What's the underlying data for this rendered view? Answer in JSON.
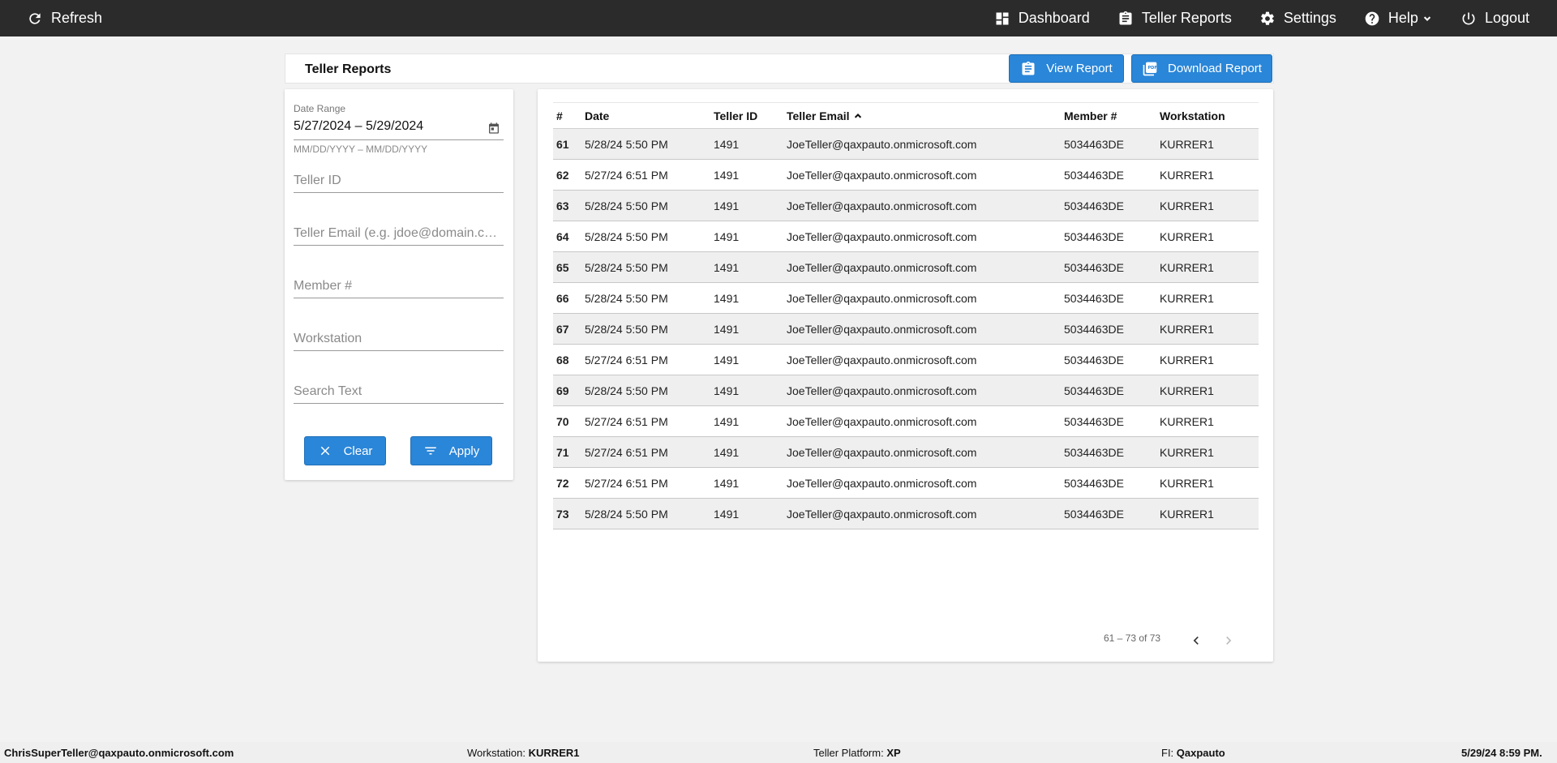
{
  "topbar": {
    "refresh": "Refresh",
    "nav": [
      {
        "label": "Dashboard",
        "icon": "dashboard-icon"
      },
      {
        "label": "Teller Reports",
        "icon": "clipboard-icon"
      },
      {
        "label": "Settings",
        "icon": "gear-icon"
      },
      {
        "label": "Help",
        "icon": "help-icon"
      },
      {
        "label": "Logout",
        "icon": "power-icon"
      }
    ]
  },
  "header": {
    "title": "Teller Reports",
    "view_report": "View Report",
    "download_report": "Download Report"
  },
  "filters": {
    "date_range_label": "Date Range",
    "date_range_value": "5/27/2024 – 5/29/2024",
    "date_range_hint": "MM/DD/YYYY – MM/DD/YYYY",
    "teller_id_placeholder": "Teller ID",
    "teller_email_placeholder": "Teller Email (e.g. jdoe@domain.com)",
    "member_placeholder": "Member #",
    "workstation_placeholder": "Workstation",
    "search_placeholder": "Search Text",
    "clear": "Clear",
    "apply": "Apply"
  },
  "table": {
    "columns": [
      "#",
      "Date",
      "Teller ID",
      "Teller Email",
      "Member #",
      "Workstation"
    ],
    "sorted_column": "Teller Email",
    "rows": [
      [
        "61",
        "5/28/24 5:50 PM",
        "1491",
        "JoeTeller@qaxpauto.onmicrosoft.com",
        "5034463DE",
        "KURRER1"
      ],
      [
        "62",
        "5/27/24 6:51 PM",
        "1491",
        "JoeTeller@qaxpauto.onmicrosoft.com",
        "5034463DE",
        "KURRER1"
      ],
      [
        "63",
        "5/28/24 5:50 PM",
        "1491",
        "JoeTeller@qaxpauto.onmicrosoft.com",
        "5034463DE",
        "KURRER1"
      ],
      [
        "64",
        "5/28/24 5:50 PM",
        "1491",
        "JoeTeller@qaxpauto.onmicrosoft.com",
        "5034463DE",
        "KURRER1"
      ],
      [
        "65",
        "5/28/24 5:50 PM",
        "1491",
        "JoeTeller@qaxpauto.onmicrosoft.com",
        "5034463DE",
        "KURRER1"
      ],
      [
        "66",
        "5/28/24 5:50 PM",
        "1491",
        "JoeTeller@qaxpauto.onmicrosoft.com",
        "5034463DE",
        "KURRER1"
      ],
      [
        "67",
        "5/28/24 5:50 PM",
        "1491",
        "JoeTeller@qaxpauto.onmicrosoft.com",
        "5034463DE",
        "KURRER1"
      ],
      [
        "68",
        "5/27/24 6:51 PM",
        "1491",
        "JoeTeller@qaxpauto.onmicrosoft.com",
        "5034463DE",
        "KURRER1"
      ],
      [
        "69",
        "5/28/24 5:50 PM",
        "1491",
        "JoeTeller@qaxpauto.onmicrosoft.com",
        "5034463DE",
        "KURRER1"
      ],
      [
        "70",
        "5/27/24 6:51 PM",
        "1491",
        "JoeTeller@qaxpauto.onmicrosoft.com",
        "5034463DE",
        "KURRER1"
      ],
      [
        "71",
        "5/27/24 6:51 PM",
        "1491",
        "JoeTeller@qaxpauto.onmicrosoft.com",
        "5034463DE",
        "KURRER1"
      ],
      [
        "72",
        "5/27/24 6:51 PM",
        "1491",
        "JoeTeller@qaxpauto.onmicrosoft.com",
        "5034463DE",
        "KURRER1"
      ],
      [
        "73",
        "5/28/24 5:50 PM",
        "1491",
        "JoeTeller@qaxpauto.onmicrosoft.com",
        "5034463DE",
        "KURRER1"
      ]
    ],
    "pager": "61 – 73 of 73"
  },
  "footer": {
    "user": "ChrisSuperTeller@qaxpauto.onmicrosoft.com",
    "workstation_label": "Workstation:",
    "workstation": "KURRER1",
    "platform_label": "Teller Platform:",
    "platform": "XP",
    "fi_label": "FI:",
    "fi": "Qaxpauto",
    "datetime": "5/29/24 8:59 PM."
  },
  "colors": {
    "topbar": "#2b2b2b",
    "accent": "#2a86d8",
    "background": "#f2f2f2",
    "row_alt": "#efefef"
  }
}
